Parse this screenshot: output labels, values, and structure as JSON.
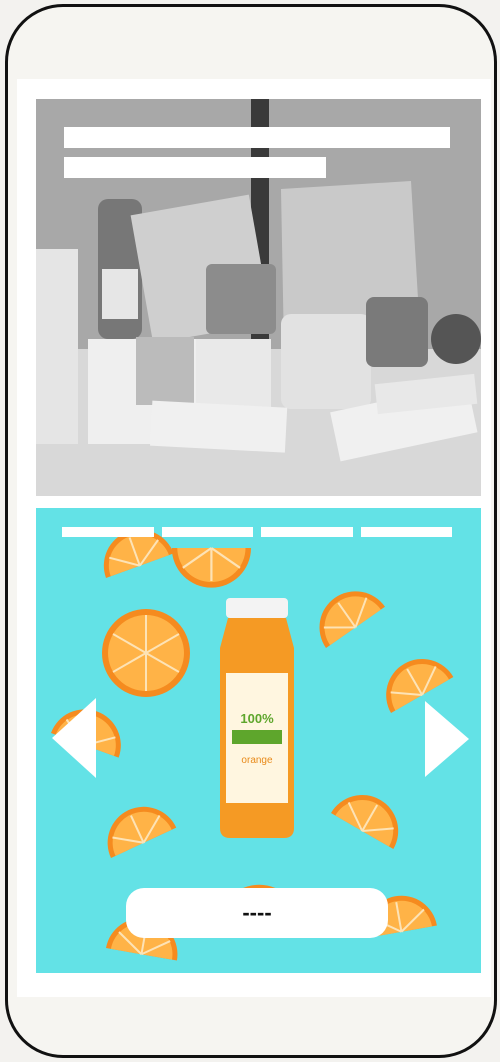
{
  "carousel": {
    "indicator_count": 4,
    "active_index": 0,
    "cta_label": "----",
    "background_color": "#63e2e6"
  },
  "top_banner": {
    "title_placeholder_lines": 2
  }
}
